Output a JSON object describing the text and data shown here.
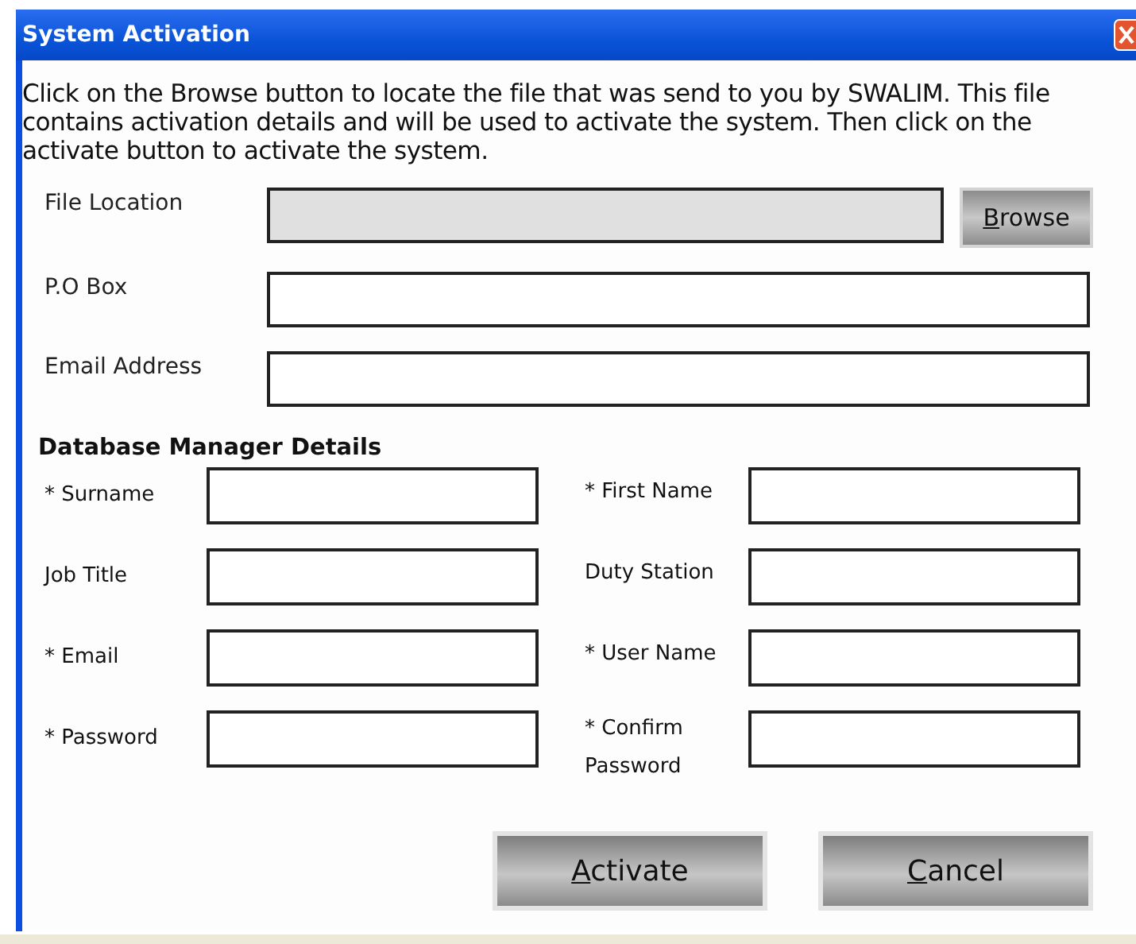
{
  "window": {
    "title": "System Activation"
  },
  "instructions": "Click on the Browse button to locate the file that was send to you by SWALIM. This file contains activation details and will be used to activate the system. Then click on the activate button to activate the system.",
  "top_fields": [
    {
      "label": "File Location",
      "disabled": true,
      "button": {
        "key": "B",
        "rest": "rowse"
      }
    },
    {
      "label": "P.O Box",
      "disabled": false
    },
    {
      "label": "Email Address",
      "disabled": false
    }
  ],
  "section": {
    "title": "Database Manager Details",
    "fields": [
      {
        "label": "* Surname"
      },
      {
        "label": "* First Name"
      },
      {
        "label": "Job Title"
      },
      {
        "label": "Duty Station"
      },
      {
        "label": "* Email"
      },
      {
        "label": "* User Name"
      },
      {
        "label": "* Password"
      },
      {
        "label": "* Confirm Password"
      }
    ]
  },
  "buttons": [
    {
      "key": "A",
      "rest": "ctivate"
    },
    {
      "key": "C",
      "rest": "ancel"
    }
  ]
}
